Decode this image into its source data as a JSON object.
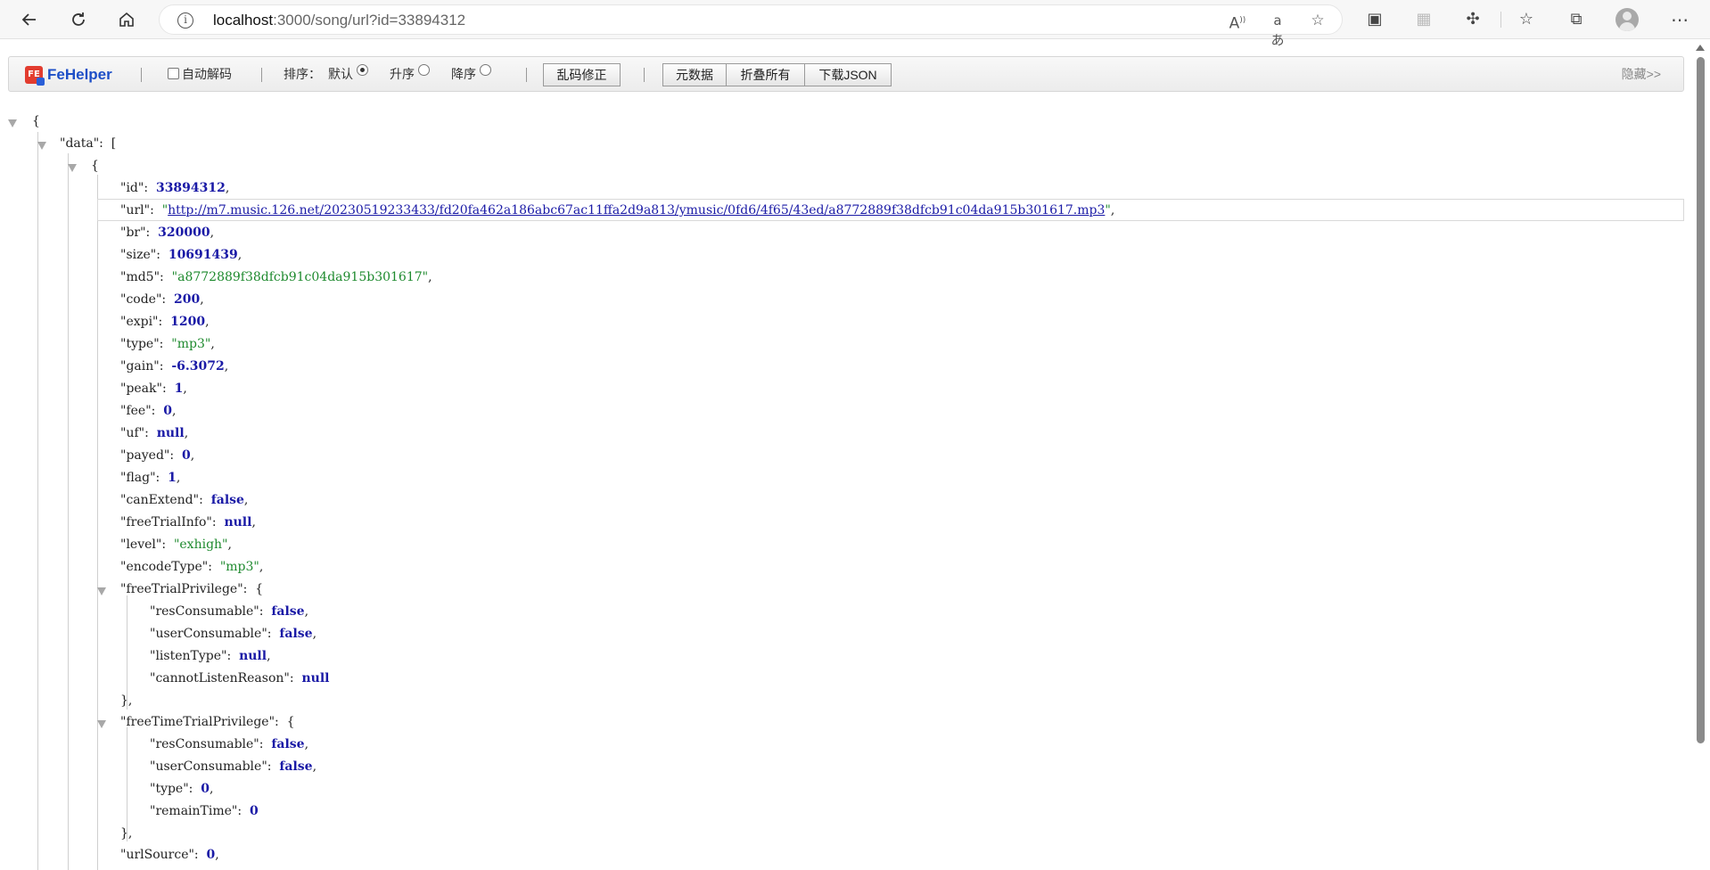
{
  "browser": {
    "url_host": "localhost",
    "url_path": ":3000/song/url?id=33894312",
    "icons": [
      "back-icon",
      "refresh-icon",
      "home-icon",
      "site-info-icon",
      "read-aloud-icon",
      "translate-icon",
      "add-favorite-icon",
      "extension-icon",
      "extension-icon",
      "extensions-puzzle-icon",
      "favorites-icon",
      "collections-icon",
      "profile-icon",
      "more-icon"
    ]
  },
  "fehelper": {
    "logo_text": "FeHelper",
    "auto_decode_label": "自动解码",
    "sort_label": "排序：",
    "sort_default": "默认",
    "sort_asc": "升序",
    "sort_desc": "降序",
    "garble_fix_button": "乱码修正",
    "metadata_button": "元数据",
    "collapse_all_button": "折叠所有",
    "download_json_button": "下载JSON",
    "hide_link": "隐藏>>"
  },
  "json": {
    "root_open": "{",
    "data_key": "\"data\"",
    "data_open": "[",
    "item_open": "{",
    "fields": {
      "id": {
        "key": "\"id\"",
        "value": "33894312"
      },
      "url": {
        "key": "\"url\"",
        "value": "http://m7.music.126.net/20230519233433/fd20fa462a186abc67ac11ffa2d9a813/ymusic/0fd6/4f65/43ed/a8772889f38dfcb91c04da915b301617.mp3"
      },
      "br": {
        "key": "\"br\"",
        "value": "320000"
      },
      "size": {
        "key": "\"size\"",
        "value": "10691439"
      },
      "md5": {
        "key": "\"md5\"",
        "value": "\"a8772889f38dfcb91c04da915b301617\""
      },
      "code": {
        "key": "\"code\"",
        "value": "200"
      },
      "expi": {
        "key": "\"expi\"",
        "value": "1200"
      },
      "type": {
        "key": "\"type\"",
        "value": "\"mp3\""
      },
      "gain": {
        "key": "\"gain\"",
        "value": "-6.3072"
      },
      "peak": {
        "key": "\"peak\"",
        "value": "1"
      },
      "fee": {
        "key": "\"fee\"",
        "value": "0"
      },
      "uf": {
        "key": "\"uf\"",
        "value": "null"
      },
      "payed": {
        "key": "\"payed\"",
        "value": "0"
      },
      "flag": {
        "key": "\"flag\"",
        "value": "1"
      },
      "canExtend": {
        "key": "\"canExtend\"",
        "value": "false"
      },
      "freeTrialInfo": {
        "key": "\"freeTrialInfo\"",
        "value": "null"
      },
      "level": {
        "key": "\"level\"",
        "value": "\"exhigh\""
      },
      "encodeType": {
        "key": "\"encodeType\"",
        "value": "\"mp3\""
      },
      "freeTrialPrivilege": {
        "key": "\"freeTrialPrivilege\"",
        "resConsumable": {
          "key": "\"resConsumable\"",
          "value": "false"
        },
        "userConsumable": {
          "key": "\"userConsumable\"",
          "value": "false"
        },
        "listenType": {
          "key": "\"listenType\"",
          "value": "null"
        },
        "cannotListenReason": {
          "key": "\"cannotListenReason\"",
          "value": "null"
        }
      },
      "freeTimeTrialPrivilege": {
        "key": "\"freeTimeTrialPrivilege\"",
        "resConsumable": {
          "key": "\"resConsumable\"",
          "value": "false"
        },
        "userConsumable": {
          "key": "\"userConsumable\"",
          "value": "false"
        },
        "type": {
          "key": "\"type\"",
          "value": "0"
        },
        "remainTime": {
          "key": "\"remainTime\"",
          "value": "0"
        }
      },
      "urlSource": {
        "key": "\"urlSource\"",
        "value": "0"
      }
    }
  }
}
